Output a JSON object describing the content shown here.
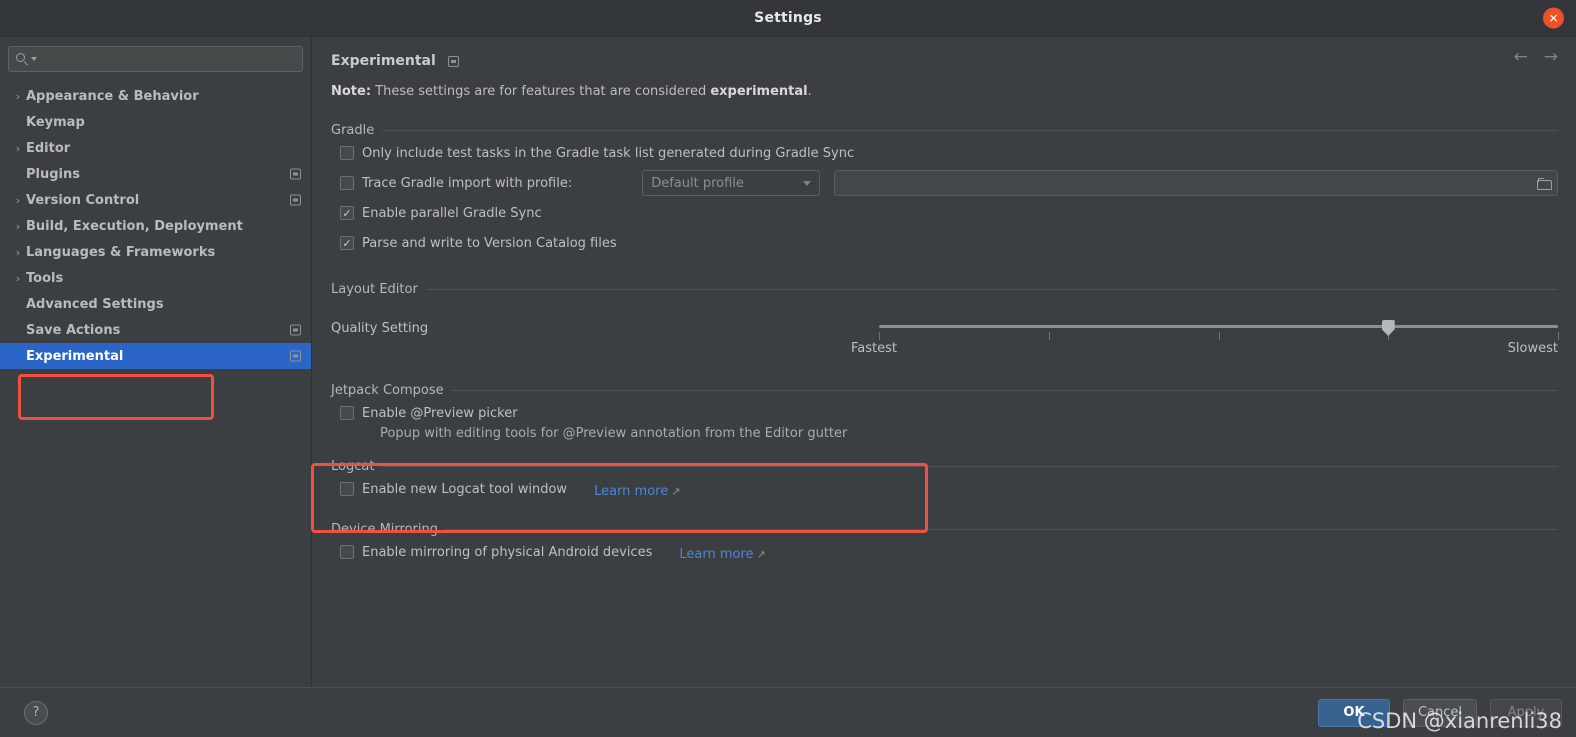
{
  "window": {
    "title": "Settings",
    "close_label": "✕"
  },
  "sidebar": {
    "search": {
      "value": "",
      "placeholder": ""
    },
    "items": [
      {
        "label": "Appearance & Behavior",
        "arrow": "›",
        "has_arrow": true,
        "modified": false,
        "selected": false
      },
      {
        "label": "Keymap",
        "arrow": "",
        "has_arrow": false,
        "modified": false,
        "selected": false
      },
      {
        "label": "Editor",
        "arrow": "›",
        "has_arrow": true,
        "modified": false,
        "selected": false
      },
      {
        "label": "Plugins",
        "arrow": "",
        "has_arrow": false,
        "modified": true,
        "selected": false
      },
      {
        "label": "Version Control",
        "arrow": "›",
        "has_arrow": true,
        "modified": true,
        "selected": false
      },
      {
        "label": "Build, Execution, Deployment",
        "arrow": "›",
        "has_arrow": true,
        "modified": false,
        "selected": false
      },
      {
        "label": "Languages & Frameworks",
        "arrow": "›",
        "has_arrow": true,
        "modified": false,
        "selected": false
      },
      {
        "label": "Tools",
        "arrow": "›",
        "has_arrow": true,
        "modified": false,
        "selected": false
      },
      {
        "label": "Advanced Settings",
        "arrow": "",
        "has_arrow": false,
        "modified": false,
        "selected": false
      },
      {
        "label": "Save Actions",
        "arrow": "",
        "has_arrow": false,
        "modified": true,
        "selected": false
      },
      {
        "label": "Experimental",
        "arrow": "",
        "has_arrow": false,
        "modified": true,
        "selected": true
      }
    ]
  },
  "content": {
    "title": "Experimental",
    "nav_back": "←",
    "nav_forward": "→",
    "note_prefix": "Note:",
    "note_text": " These settings are for features that are considered ",
    "note_emphasis": "experimental",
    "note_suffix": ".",
    "gradle": {
      "title": "Gradle",
      "only_include_test_tasks": {
        "label": "Only include test tasks in the Gradle task list generated during Gradle Sync",
        "checked": false
      },
      "trace_gradle_import": {
        "label": "Trace Gradle import with profile:",
        "checked": false,
        "profile_value": "Default profile",
        "path_value": "",
        "path_placeholder": ""
      },
      "enable_parallel_sync": {
        "label": "Enable parallel Gradle Sync",
        "checked": true
      },
      "parse_version_catalog": {
        "label": "Parse and write to Version Catalog files",
        "checked": true
      }
    },
    "layout_editor": {
      "title": "Layout Editor",
      "quality_label": "Quality Setting",
      "slider_min_label": "Fastest",
      "slider_max_label": "Slowest",
      "slider_value": 4,
      "slider_ticks": 5
    },
    "jetpack_compose": {
      "title": "Jetpack Compose",
      "preview_picker": {
        "label": "Enable @Preview picker",
        "checked": false
      },
      "preview_picker_note": "Popup with editing tools for @Preview annotation from the Editor gutter"
    },
    "logcat": {
      "title": "Logcat",
      "enable_new_logcat": {
        "label": "Enable new Logcat tool window",
        "checked": false
      },
      "learn_more": "Learn more",
      "learn_more_arrow": "↗"
    },
    "device_mirroring": {
      "title": "Device Mirroring",
      "enable_mirroring": {
        "label": "Enable mirroring of physical Android devices",
        "checked": false
      },
      "learn_more": "Learn more",
      "learn_more_arrow": "↗"
    }
  },
  "footer": {
    "help_label": "?",
    "ok_label": "OK",
    "cancel_label": "Cancel",
    "apply_label": "Apply"
  },
  "watermark": "CSDN @xianrenli38",
  "colors": {
    "selection_blue": "#2b65c8",
    "highlight_red": "#f2503f",
    "link_blue": "#4a86d8",
    "primary_button": "#37618f",
    "close_orange": "#ef5026",
    "background": "#3c3f41"
  }
}
